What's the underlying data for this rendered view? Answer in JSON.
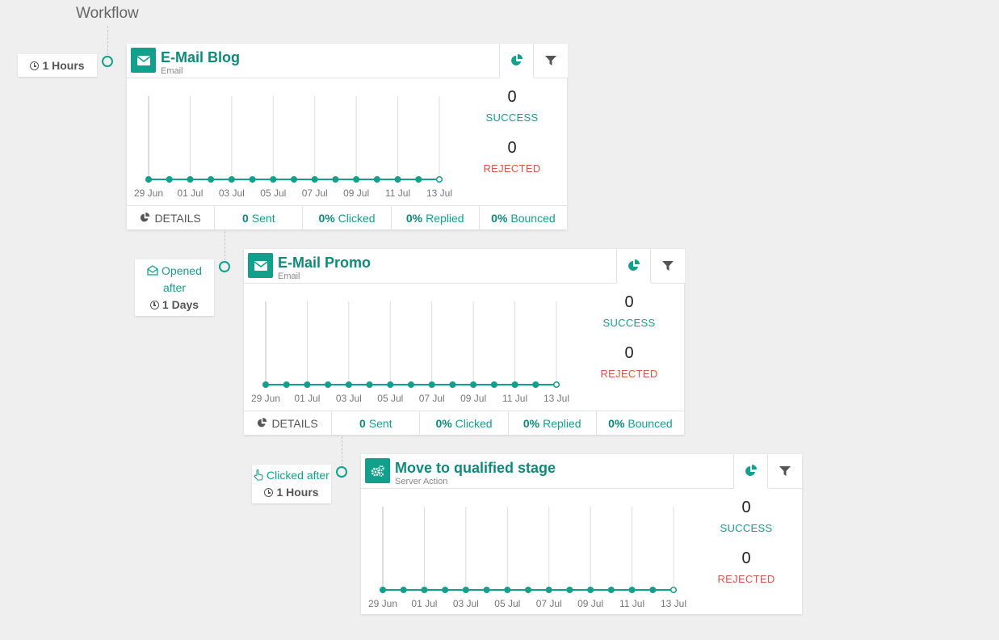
{
  "page": {
    "title": "Workflow"
  },
  "colors": {
    "accent": "#12a08c",
    "rejected": "#d9534f",
    "grid": "#dcdcdc"
  },
  "x_ticks": [
    "29 Jun",
    "01 Jul",
    "03 Jul",
    "05 Jul",
    "07 Jul",
    "09 Jul",
    "11 Jul",
    "13 Jul"
  ],
  "activities": [
    {
      "title": "E-Mail Blog",
      "type": "Email",
      "icon": "envelope-icon",
      "trigger": {
        "duration": "1 Hours"
      },
      "success_count": "0",
      "success_label": "SUCCESS",
      "rejected_count": "0",
      "rejected_label": "REJECTED",
      "footer": {
        "details": "DETAILS",
        "sent_num": "0",
        "sent_label": "Sent",
        "clicked_num": "0%",
        "clicked_label": "Clicked",
        "replied_num": "0%",
        "replied_label": "Replied",
        "bounced_num": "0%",
        "bounced_label": "Bounced"
      }
    },
    {
      "title": "E-Mail Promo",
      "type": "Email",
      "icon": "envelope-icon",
      "trigger": {
        "label_1": "Opened",
        "label_2": "after",
        "duration": "1 Days"
      },
      "success_count": "0",
      "success_label": "SUCCESS",
      "rejected_count": "0",
      "rejected_label": "REJECTED",
      "footer": {
        "details": "DETAILS",
        "sent_num": "0",
        "sent_label": "Sent",
        "clicked_num": "0%",
        "clicked_label": "Clicked",
        "replied_num": "0%",
        "replied_label": "Replied",
        "bounced_num": "0%",
        "bounced_label": "Bounced"
      }
    },
    {
      "title": "Move to qualified stage",
      "type": "Server Action",
      "icon": "gears-icon",
      "trigger": {
        "label_1": "Clicked after",
        "duration": "1 Hours"
      },
      "success_count": "0",
      "success_label": "SUCCESS",
      "rejected_count": "0",
      "rejected_label": "REJECTED"
    }
  ],
  "chart_data": [
    {
      "type": "line",
      "x": [
        "29 Jun",
        "30 Jun",
        "01 Jul",
        "02 Jul",
        "03 Jul",
        "04 Jul",
        "05 Jul",
        "06 Jul",
        "07 Jul",
        "08 Jul",
        "09 Jul",
        "10 Jul",
        "11 Jul",
        "12 Jul",
        "13 Jul"
      ],
      "values": [
        0,
        0,
        0,
        0,
        0,
        0,
        0,
        0,
        0,
        0,
        0,
        0,
        0,
        0,
        0
      ]
    },
    {
      "type": "line",
      "x": [
        "29 Jun",
        "30 Jun",
        "01 Jul",
        "02 Jul",
        "03 Jul",
        "04 Jul",
        "05 Jul",
        "06 Jul",
        "07 Jul",
        "08 Jul",
        "09 Jul",
        "10 Jul",
        "11 Jul",
        "12 Jul",
        "13 Jul"
      ],
      "values": [
        0,
        0,
        0,
        0,
        0,
        0,
        0,
        0,
        0,
        0,
        0,
        0,
        0,
        0,
        0
      ]
    },
    {
      "type": "line",
      "x": [
        "29 Jun",
        "30 Jun",
        "01 Jul",
        "02 Jul",
        "03 Jul",
        "04 Jul",
        "05 Jul",
        "06 Jul",
        "07 Jul",
        "08 Jul",
        "09 Jul",
        "10 Jul",
        "11 Jul",
        "12 Jul",
        "13 Jul"
      ],
      "values": [
        0,
        0,
        0,
        0,
        0,
        0,
        0,
        0,
        0,
        0,
        0,
        0,
        0,
        0,
        0
      ]
    }
  ]
}
